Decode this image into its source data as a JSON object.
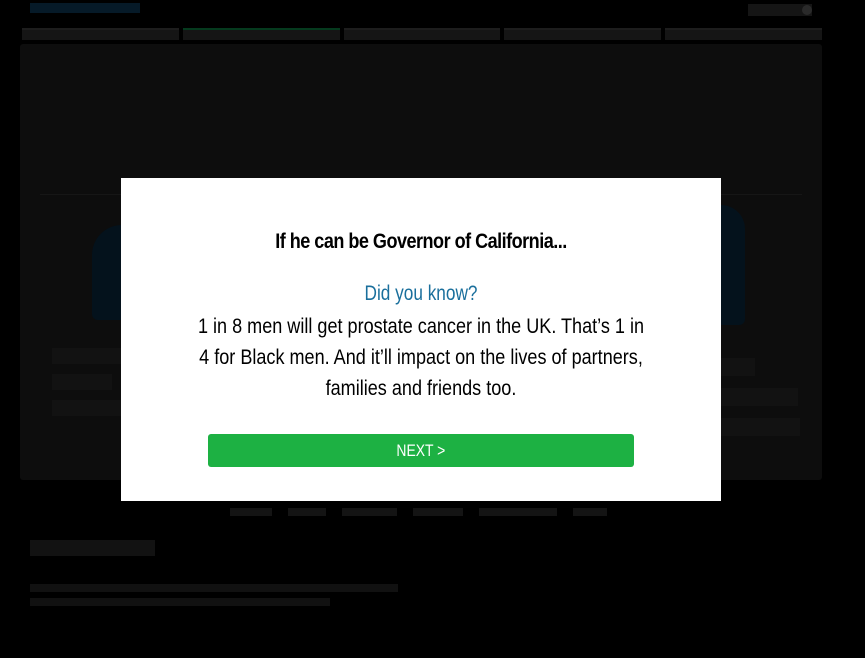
{
  "modal": {
    "title": "If he can be Governor of California...",
    "subtitle": "Did you know?",
    "body": "1 in 8 men will get prostate cancer in the UK. That’s 1 in 4 for Black men. And it’ll impact on the lives of partners, families and friends too.",
    "next_label": "NEXT >"
  },
  "colors": {
    "accent_green": "#1db143",
    "subtitle_blue": "#1a6f9c",
    "overlay": "#000000",
    "modal_bg": "#ffffff"
  }
}
